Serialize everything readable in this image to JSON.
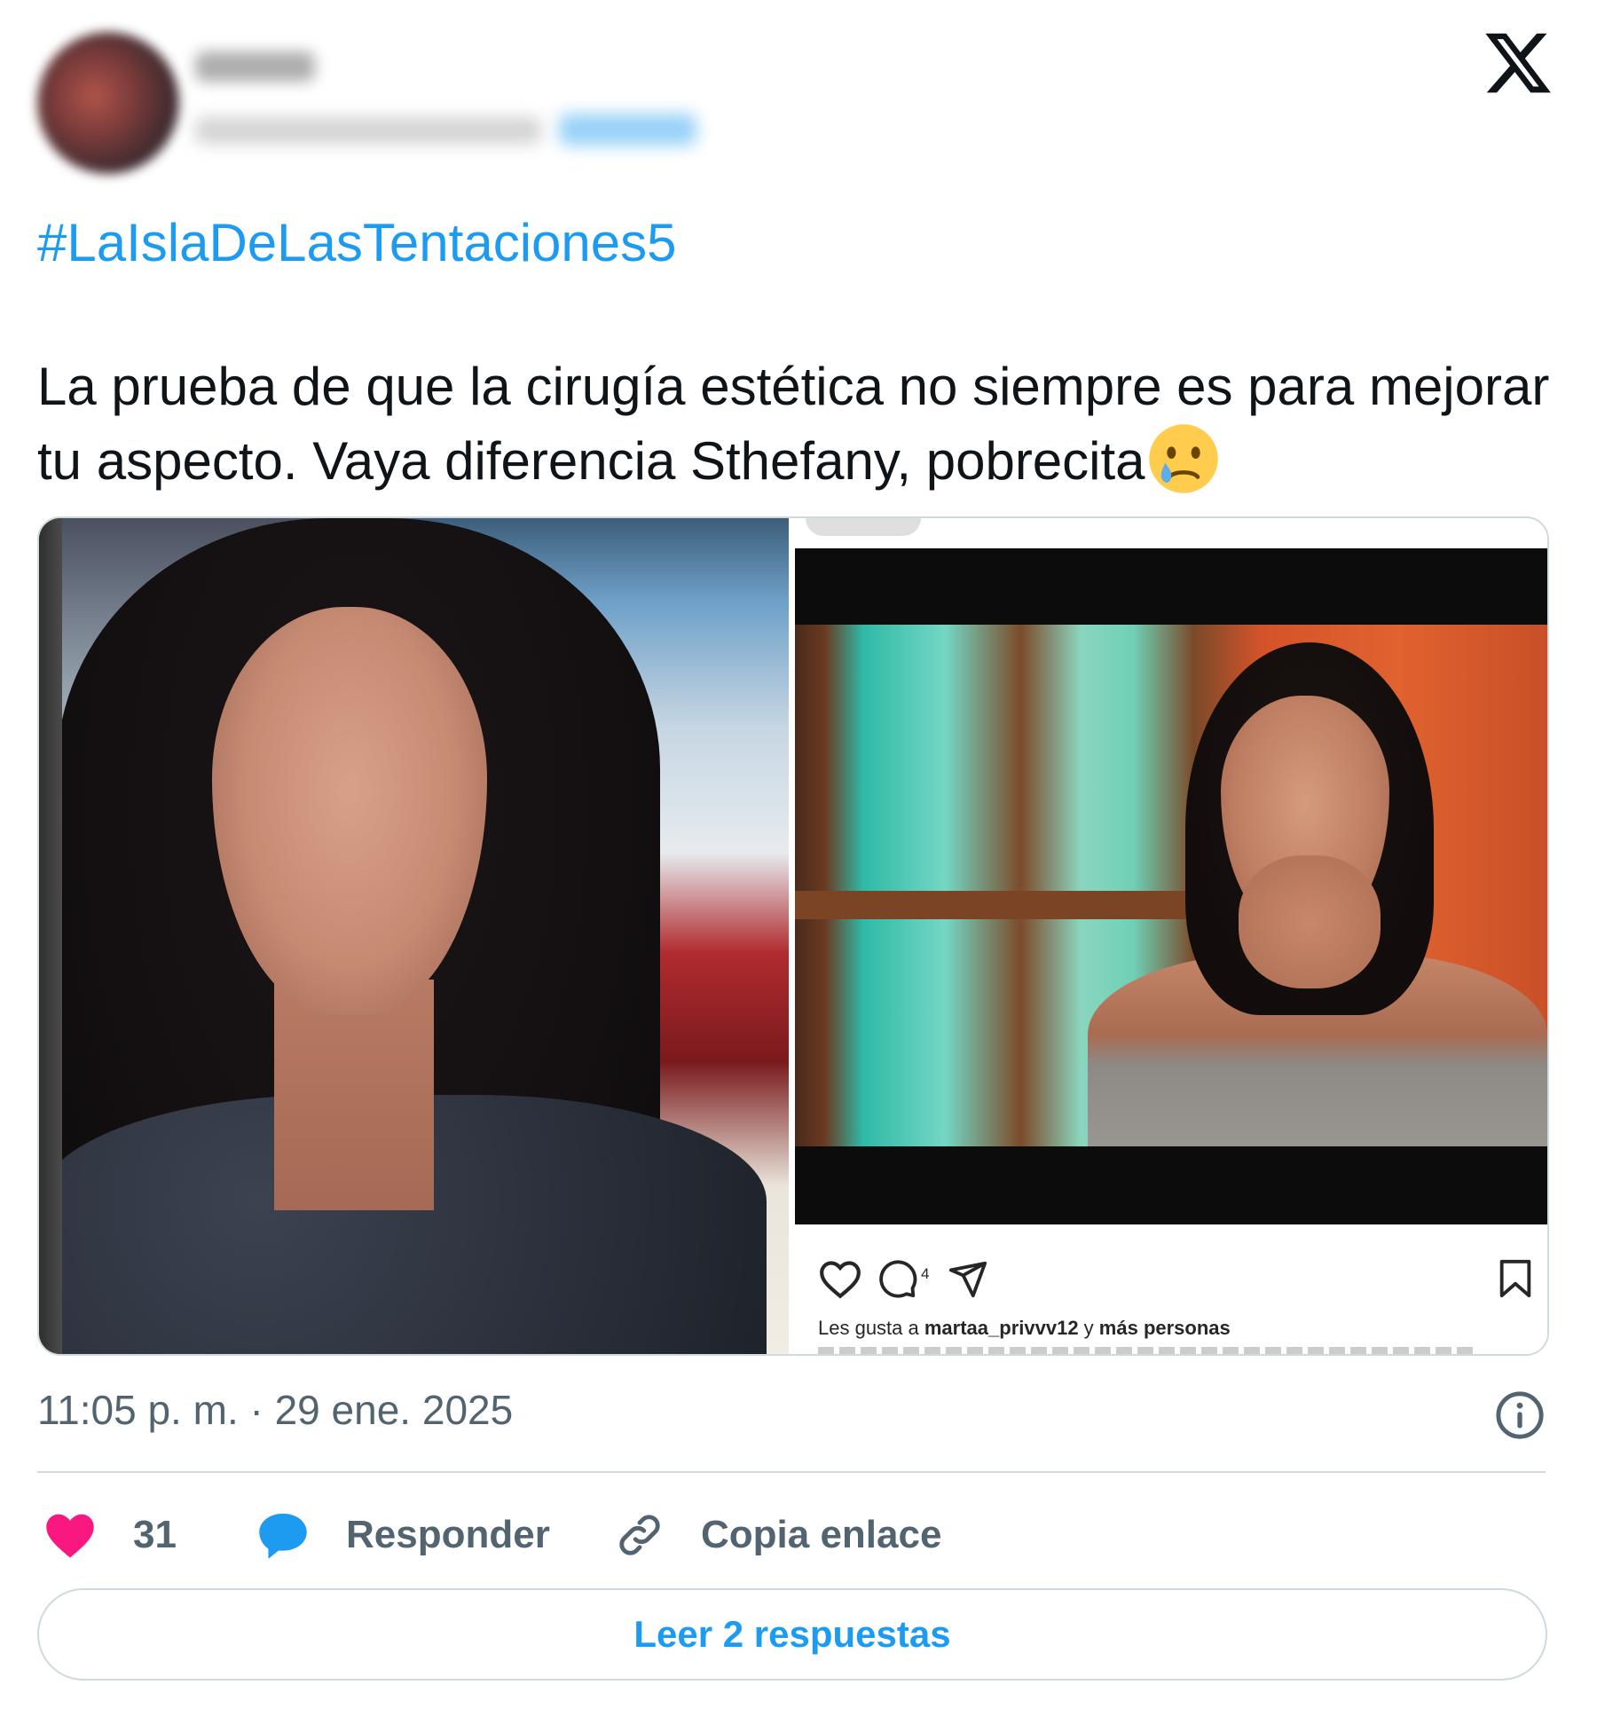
{
  "header": {
    "display_name": "",
    "handle": "",
    "follow_label": ""
  },
  "tweet": {
    "hashtag": "#LaIslaDeLasTentaciones5",
    "text": "La prueba de que la cirugía estética no siempre es para mejorar tu aspecto. Vaya diferencia Sthefany, pobrecita",
    "emoji": "crying-face",
    "timestamp": "11:05 p. m. · 29 ene. 2025"
  },
  "media": {
    "instagram_overlay": {
      "comment_count": "4",
      "likes_text_prefix": "Les gusta a ",
      "likes_user": "martaa_privvv12",
      "likes_text_middle": " y ",
      "likes_text_suffix": "más personas"
    }
  },
  "actions": {
    "like_count": "31",
    "reply_label": "Responder",
    "copy_label": "Copia enlace",
    "read_replies_label": "Leer 2 respuestas"
  },
  "colors": {
    "accent": "#1d9bf0",
    "like": "#f91880",
    "muted": "#536471",
    "border": "#cfd9de"
  },
  "icons": [
    "x-logo-icon",
    "info-icon",
    "heart-icon",
    "reply-bubble-icon",
    "link-icon",
    "ig-heart-icon",
    "ig-comment-icon",
    "ig-share-icon",
    "ig-bookmark-icon"
  ]
}
